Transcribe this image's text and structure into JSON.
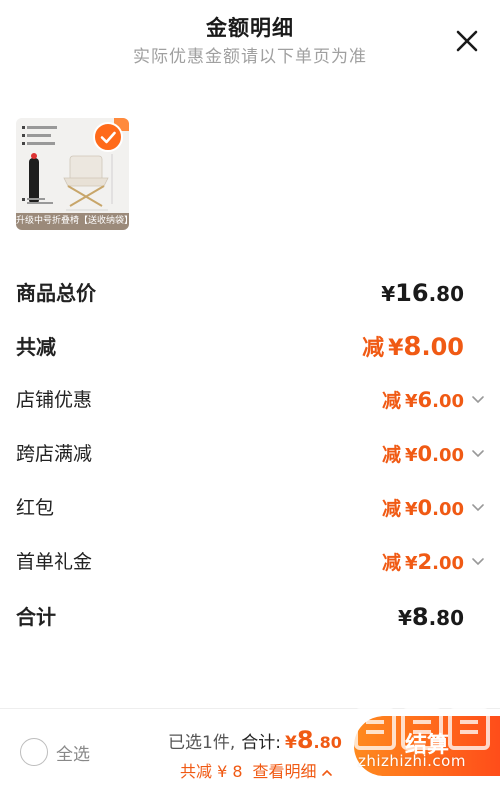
{
  "header": {
    "title": "金额明细",
    "subtitle": "实际优惠金额请以下单页为准"
  },
  "product": {
    "caption": "升级中号折叠椅【送收纳袋】"
  },
  "rows": {
    "subtotal": {
      "label": "商品总价",
      "yuan": "¥",
      "int": "16",
      "dec": ".80"
    },
    "total_reduce": {
      "label": "共减",
      "prefix": "减",
      "yuan": "¥",
      "int": "8",
      "dec": ".00"
    },
    "shop_coupon": {
      "label": "店铺优惠",
      "prefix": "减",
      "yuan": "¥",
      "int": "6",
      "dec": ".00"
    },
    "cross_store": {
      "label": "跨店满减",
      "prefix": "减",
      "yuan": "¥",
      "int": "0",
      "dec": ".00"
    },
    "red_packet": {
      "label": "红包",
      "prefix": "减",
      "yuan": "¥",
      "int": "0",
      "dec": ".00"
    },
    "first_order": {
      "label": "首单礼金",
      "prefix": "减",
      "yuan": "¥",
      "int": "2",
      "dec": ".00"
    },
    "total": {
      "label": "合计",
      "yuan": "¥",
      "int": "8",
      "dec": ".80"
    }
  },
  "footer": {
    "select_all": "全选",
    "selected_count": "已选1件,",
    "total_label": "合计:",
    "total_yuan": "¥",
    "total_int": "8",
    "total_dec": ".80",
    "discount_line": "共减 ¥ 8",
    "detail_link": "查看明细",
    "checkout": "结算"
  },
  "watermark": {
    "text": "zhizhizhi.com"
  },
  "colors": {
    "accent": "#f05a14",
    "checkout_from": "#ff8a1e",
    "checkout_to": "#ff4d1a"
  }
}
